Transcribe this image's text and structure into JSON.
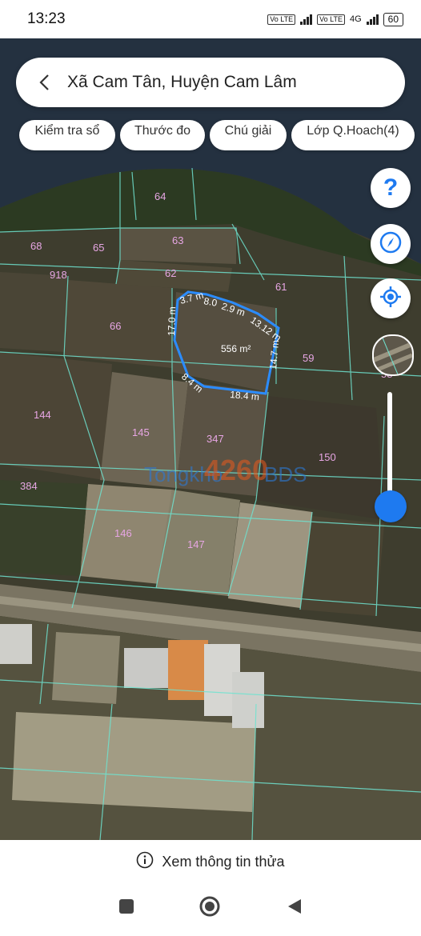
{
  "status": {
    "time": "13:23",
    "net1": "Vo LTE",
    "net2": "Vo LTE",
    "net_type": "4G",
    "battery": "60"
  },
  "search": {
    "location": "Xã Cam Tân, Huyện Cam Lâm"
  },
  "chips": [
    {
      "label": "Kiểm tra sổ"
    },
    {
      "label": "Thước đo"
    },
    {
      "label": "Chú giải"
    },
    {
      "label": "Lớp Q.Hoach(4)"
    }
  ],
  "map": {
    "parcels": [
      "64",
      "68",
      "65",
      "63",
      "918",
      "62",
      "61",
      "66",
      "59",
      "58",
      "144",
      "145",
      "347",
      "150",
      "384",
      "146",
      "147"
    ],
    "measurements": [
      "3.7 m",
      "8.0",
      "2.9 m",
      "13.12 m",
      "17.0 m",
      "14.7 m",
      "8.4 m",
      "18.4 m"
    ],
    "area": "556 m²",
    "watermark_main": "Tongkho",
    "watermark_number": "4260",
    "watermark_tail": "BDS",
    "highlight_color": "#2b8cff",
    "boundary_color": "#6fe3d0"
  },
  "zoom": {
    "level": 0.2
  },
  "bottom": {
    "info_label": "Xem thông tin thửa"
  },
  "icons": {
    "back": "chevron-left-icon",
    "help": "question-icon",
    "compass": "compass-icon",
    "locate": "locate-icon",
    "info": "info-icon"
  }
}
